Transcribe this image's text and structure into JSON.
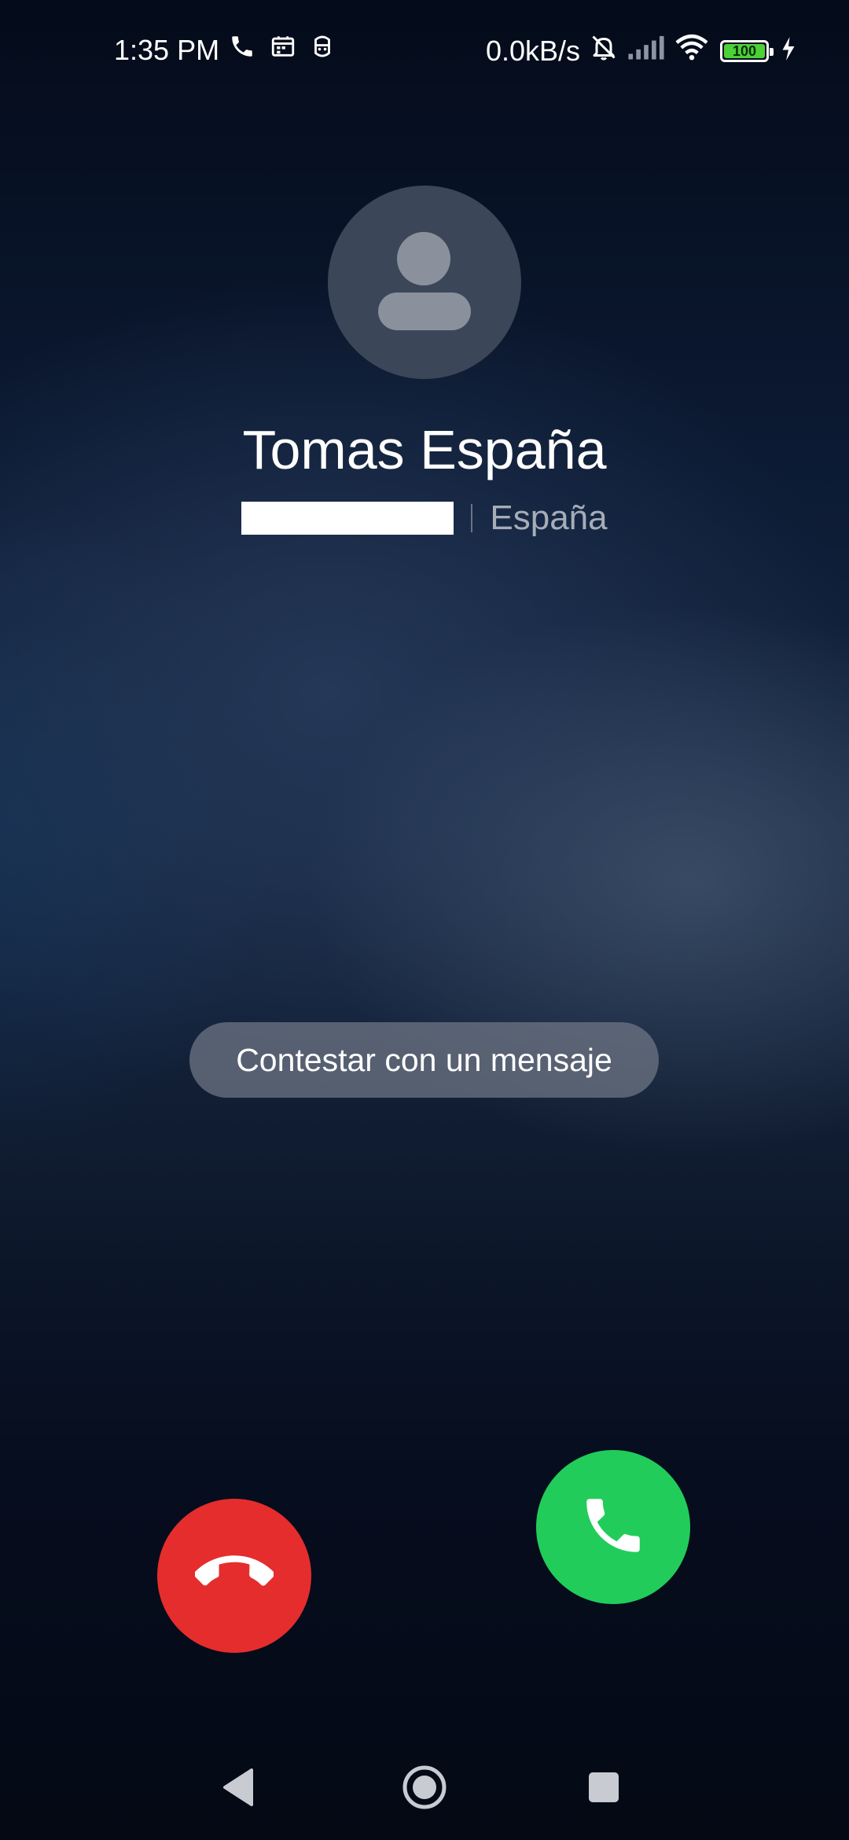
{
  "status_bar": {
    "time": "1:35 PM",
    "network_speed": "0.0kB/s",
    "battery_level": "100",
    "icons": [
      "phone-icon",
      "calendar-icon",
      "robot-icon",
      "mute-bell-icon",
      "signal-icon",
      "wifi-icon",
      "battery-icon",
      "charging-icon"
    ]
  },
  "caller": {
    "name": "Tomas España",
    "location": "España",
    "avatar_icon": "person-placeholder-icon"
  },
  "actions": {
    "reply_message_label": "Contestar con un mensaje",
    "decline_icon": "hang-up-icon",
    "accept_icon": "phone-icon"
  },
  "colors": {
    "decline": "#e52d2d",
    "accept": "#22cc5a",
    "battery_fill": "#4cd137"
  },
  "nav_bar": {
    "icons": [
      "back-icon",
      "home-icon",
      "recents-icon"
    ]
  }
}
